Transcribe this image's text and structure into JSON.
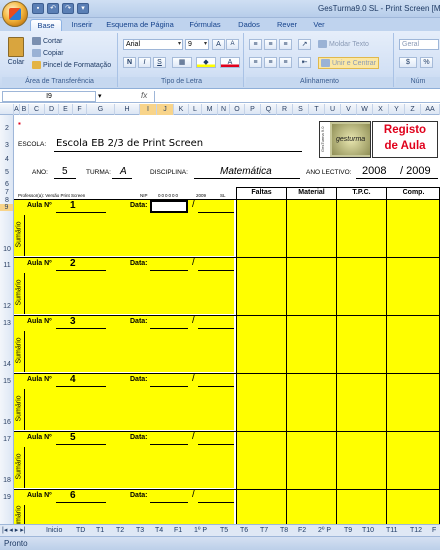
{
  "window": {
    "title": "GesTurma9.0 SL - Print Screen [M"
  },
  "ribbon_tabs": [
    "Base",
    "Inserir",
    "Esquema de Página",
    "Fórmulas",
    "Dados",
    "Rever",
    "Ver"
  ],
  "clipboard": {
    "paste": "Colar",
    "cut": "Cortar",
    "copy": "Copiar",
    "format_painter": "Pincel de Formatação",
    "group": "Área de Transferência"
  },
  "font": {
    "name": "Arial",
    "size": "9",
    "grow": "A",
    "shrink": "A",
    "bold": "N",
    "italic": "I",
    "underline": "S",
    "group": "Tipo de Letra"
  },
  "alignment": {
    "wrap": "Moldar Texto",
    "merge": "Unir e Centrar",
    "group": "Alinhamento"
  },
  "number": {
    "format": "Geral",
    "percent": "%",
    "group": "Núm"
  },
  "formula_bar": {
    "cell_ref": "I9",
    "fx": "fx"
  },
  "columns": [
    "A",
    "B",
    "C",
    "D",
    "E",
    "F",
    "G",
    "H",
    "I",
    "J",
    "K",
    "L",
    "M",
    "N",
    "O",
    "P",
    "Q",
    "R",
    "S",
    "T",
    "U",
    "V",
    "W",
    "X",
    "Y",
    "Z",
    "AA"
  ],
  "rows": [
    "2",
    "3",
    "4",
    "5",
    "6",
    "7",
    "8",
    "9",
    "10",
    "11",
    "12",
    "13",
    "14",
    "15",
    "16",
    "17",
    "18",
    "19"
  ],
  "sheet": {
    "escola_label": "ESCOLA:",
    "escola_value": "Escola EB 2/3 de Print Screen",
    "logo_text": "gesturma",
    "logo_side": "GesTurma 9.0",
    "registo_line1": "Registo",
    "registo_line2": "de Aula",
    "ano_label": "ANO:",
    "ano_value": "5",
    "turma_label": "TURMA:",
    "turma_value": "A",
    "disciplina_label": "DISCIPLINA:",
    "disciplina_value": "Matemática",
    "ano_lectivo_label": "ANO LECTIVO:",
    "ano_lectivo_start": "2008",
    "ano_lectivo_end": "/ 2009",
    "professor_label": "Professor(a): Versão Print Screen",
    "nip_label": "NIP",
    "nip_value": "000000",
    "year_small": "2009",
    "sl_small": "SL",
    "col_faltas": "Faltas",
    "col_material": "Material",
    "col_tpc": "T.P.C.",
    "col_comp": "Comp.",
    "aula_label": "Aula Nº",
    "data_label": "Data:",
    "slash": "/",
    "sumario_label": "Sumário"
  },
  "aulas": [
    "1",
    "2",
    "3",
    "4",
    "5",
    "6"
  ],
  "sheet_tabs": [
    "Inicio",
    "TD",
    "T1",
    "T2",
    "T3",
    "T4",
    "F1",
    "1º P",
    "T5",
    "T6",
    "T7",
    "T8",
    "F2",
    "2º P",
    "T9",
    "T10",
    "T11",
    "T12",
    "F"
  ],
  "status": {
    "text": "Pronto"
  },
  "colors": {
    "yellow": "#ffff00",
    "registo_red": "#e0001b",
    "ribbon_blue": "#d3e1f5"
  }
}
